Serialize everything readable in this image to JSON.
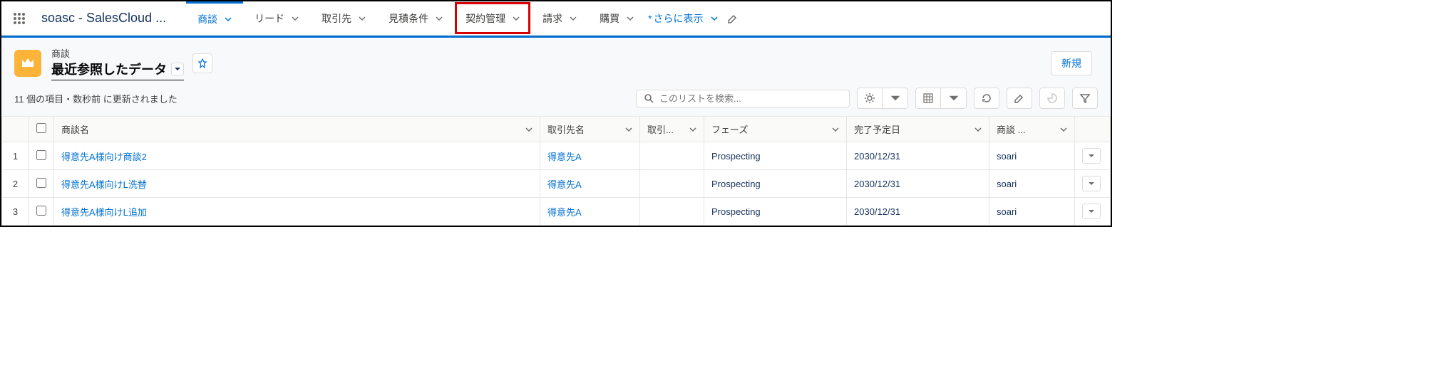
{
  "topbar": {
    "app_name": "soasc - SalesCloud ...",
    "tabs": [
      {
        "label": "商談",
        "active": true,
        "highlight": false
      },
      {
        "label": "リード",
        "active": false,
        "highlight": false
      },
      {
        "label": "取引先",
        "active": false,
        "highlight": false
      },
      {
        "label": "見積条件",
        "active": false,
        "highlight": false
      },
      {
        "label": "契約管理",
        "active": false,
        "highlight": true
      },
      {
        "label": "請求",
        "active": false,
        "highlight": false
      },
      {
        "label": "購買",
        "active": false,
        "highlight": false
      }
    ],
    "more_label": "さらに表示",
    "more_prefix": "*"
  },
  "page_header": {
    "object_label": "商談",
    "list_name": "最近参照したデータ",
    "new_button": "新規",
    "status_text": "11 個の項目・数秒前 に更新されました",
    "search_placeholder": "このリストを検索..."
  },
  "columns": [
    {
      "label": "商談名"
    },
    {
      "label": "取引先名"
    },
    {
      "label": "取引..."
    },
    {
      "label": "フェーズ"
    },
    {
      "label": "完了予定日"
    },
    {
      "label": "商談 ..."
    }
  ],
  "rows": [
    {
      "num": "1",
      "name": "得意先A様向け商談2",
      "account": "得意先A",
      "accdim": "",
      "phase": "Prospecting",
      "close": "2030/12/31",
      "owner": "soari"
    },
    {
      "num": "2",
      "name": "得意先A様向けL洗替",
      "account": "得意先A",
      "accdim": "",
      "phase": "Prospecting",
      "close": "2030/12/31",
      "owner": "soari"
    },
    {
      "num": "3",
      "name": "得意先A様向けL追加",
      "account": "得意先A",
      "accdim": "",
      "phase": "Prospecting",
      "close": "2030/12/31",
      "owner": "soari"
    }
  ]
}
